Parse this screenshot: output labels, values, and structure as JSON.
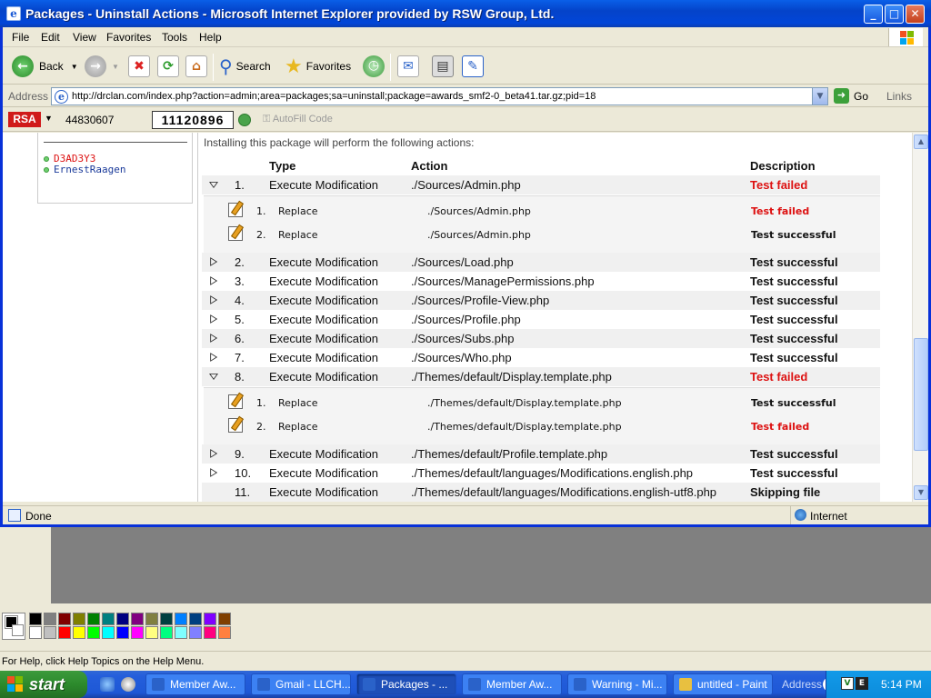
{
  "window": {
    "title": "Packages - Uninstall Actions - Microsoft Internet Explorer provided by RSW Group, Ltd."
  },
  "menu": [
    "File",
    "Edit",
    "View",
    "Favorites",
    "Tools",
    "Help"
  ],
  "toolbar": {
    "back": "Back",
    "search": "Search",
    "favorites": "Favorites"
  },
  "address": {
    "label": "Address",
    "url": "http://drclan.com/index.php?action=admin;area=packages;sa=uninstall;package=awards_smf2-0_beta41.tar.gz;pid=18",
    "go": "Go",
    "links": "Links"
  },
  "rsa": {
    "logo": "RSA",
    "serial": "44830607",
    "token": "11120896",
    "autofill": "AutoFill Code"
  },
  "sidebar": {
    "members": [
      {
        "name": "D3AD3Y3",
        "color": "#d11"
      },
      {
        "name": "ErnestRaagen",
        "color": "#1a3a9a"
      }
    ]
  },
  "package": {
    "intro": "Installing this package will perform the following actions:",
    "headers": {
      "type": "Type",
      "action": "Action",
      "description": "Description"
    },
    "actions": [
      {
        "num": "1.",
        "type": "Execute Modification",
        "file": "./Sources/Admin.php",
        "result": "Test failed",
        "status": "fail",
        "expanded": true
      },
      {
        "num": "2.",
        "type": "Execute Modification",
        "file": "./Sources/Load.php",
        "result": "Test successful",
        "status": "ok"
      },
      {
        "num": "3.",
        "type": "Execute Modification",
        "file": "./Sources/ManagePermissions.php",
        "result": "Test successful",
        "status": "ok"
      },
      {
        "num": "4.",
        "type": "Execute Modification",
        "file": "./Sources/Profile-View.php",
        "result": "Test successful",
        "status": "ok"
      },
      {
        "num": "5.",
        "type": "Execute Modification",
        "file": "./Sources/Profile.php",
        "result": "Test successful",
        "status": "ok"
      },
      {
        "num": "6.",
        "type": "Execute Modification",
        "file": "./Sources/Subs.php",
        "result": "Test successful",
        "status": "ok"
      },
      {
        "num": "7.",
        "type": "Execute Modification",
        "file": "./Sources/Who.php",
        "result": "Test successful",
        "status": "ok"
      },
      {
        "num": "8.",
        "type": "Execute Modification",
        "file": "./Themes/default/Display.template.php",
        "result": "Test failed",
        "status": "fail",
        "expanded": true
      },
      {
        "num": "9.",
        "type": "Execute Modification",
        "file": "./Themes/default/Profile.template.php",
        "result": "Test successful",
        "status": "ok"
      },
      {
        "num": "10.",
        "type": "Execute Modification",
        "file": "./Themes/default/languages/Modifications.english.php",
        "result": "Test successful",
        "status": "ok"
      },
      {
        "num": "11.",
        "type": "Execute Modification",
        "file": "./Themes/default/languages/Modifications.english-utf8.php",
        "result": "Skipping file",
        "status": "ok"
      }
    ],
    "sub1": [
      {
        "num": "1.",
        "type": "Replace",
        "file": "./Sources/Admin.php",
        "result": "Test failed",
        "status": "fail"
      },
      {
        "num": "2.",
        "type": "Replace",
        "file": "./Sources/Admin.php",
        "result": "Test successful",
        "status": "ok"
      }
    ],
    "sub8": [
      {
        "num": "1.",
        "type": "Replace",
        "file": "./Themes/default/Display.template.php",
        "result": "Test successful",
        "status": "ok"
      },
      {
        "num": "2.",
        "type": "Replace",
        "file": "./Themes/default/Display.template.php",
        "result": "Test failed",
        "status": "fail"
      }
    ]
  },
  "status": {
    "text": "Done",
    "zone": "Internet"
  },
  "paint": {
    "status": "For Help, click Help Topics on the Help Menu.",
    "palette_top": [
      "#000000",
      "#808080",
      "#800000",
      "#808000",
      "#008000",
      "#008080",
      "#000080",
      "#800080",
      "#808040",
      "#004040",
      "#0080ff",
      "#004080",
      "#8000ff",
      "#804000"
    ],
    "palette_bottom": [
      "#ffffff",
      "#c0c0c0",
      "#ff0000",
      "#ffff00",
      "#00ff00",
      "#00ffff",
      "#0000ff",
      "#ff00ff",
      "#ffff80",
      "#00ff80",
      "#80ffff",
      "#8080ff",
      "#ff0080",
      "#ff8040"
    ]
  },
  "taskbar": {
    "start": "start",
    "tasks": [
      {
        "label": "Member Aw...",
        "color": "#2a62c9"
      },
      {
        "label": "Gmail - LLCH...",
        "color": "#2a62c9"
      },
      {
        "label": "Packages - ...",
        "color": "#2a62c9",
        "active": true
      },
      {
        "label": "Member Aw...",
        "color": "#2a62c9"
      },
      {
        "label": "Warning - Mi...",
        "color": "#2a62c9"
      },
      {
        "label": "untitled - Paint",
        "color": "#e8c040"
      }
    ],
    "address": "Address",
    "time": "5:14 PM"
  }
}
